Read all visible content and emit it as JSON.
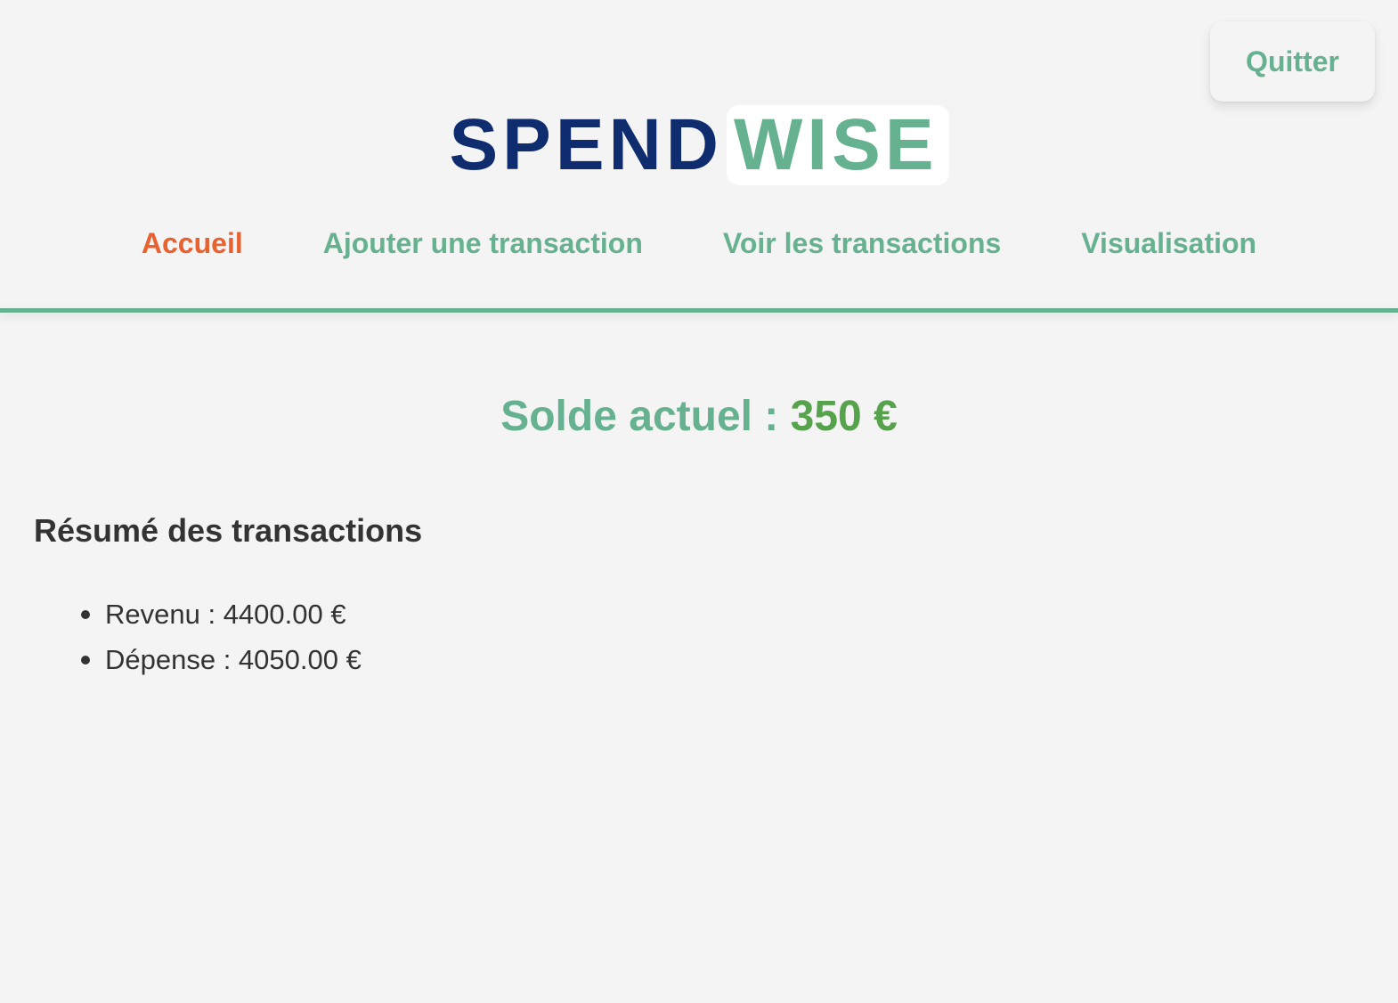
{
  "header": {
    "quit_label": "Quitter",
    "logo": {
      "part1": "SPEND",
      "part2": "WISE"
    }
  },
  "nav": {
    "items": [
      {
        "label": "Accueil",
        "active": true
      },
      {
        "label": "Ajouter une transaction",
        "active": false
      },
      {
        "label": "Voir les transactions",
        "active": false
      },
      {
        "label": "Visualisation",
        "active": false
      }
    ]
  },
  "balance": {
    "label": "Solde actuel :",
    "amount": "350 €"
  },
  "summary": {
    "title": "Résumé des transactions",
    "items": [
      {
        "text": "Revenu : 4400.00 €"
      },
      {
        "text": "Dépense : 4050.00 €"
      }
    ]
  },
  "colors": {
    "background": "#f4f4f4",
    "brand_navy": "#0f2d6e",
    "brand_green": "#66b290",
    "active_nav": "#e8612e",
    "balance_amount": "#57a24d",
    "text": "#333333"
  }
}
